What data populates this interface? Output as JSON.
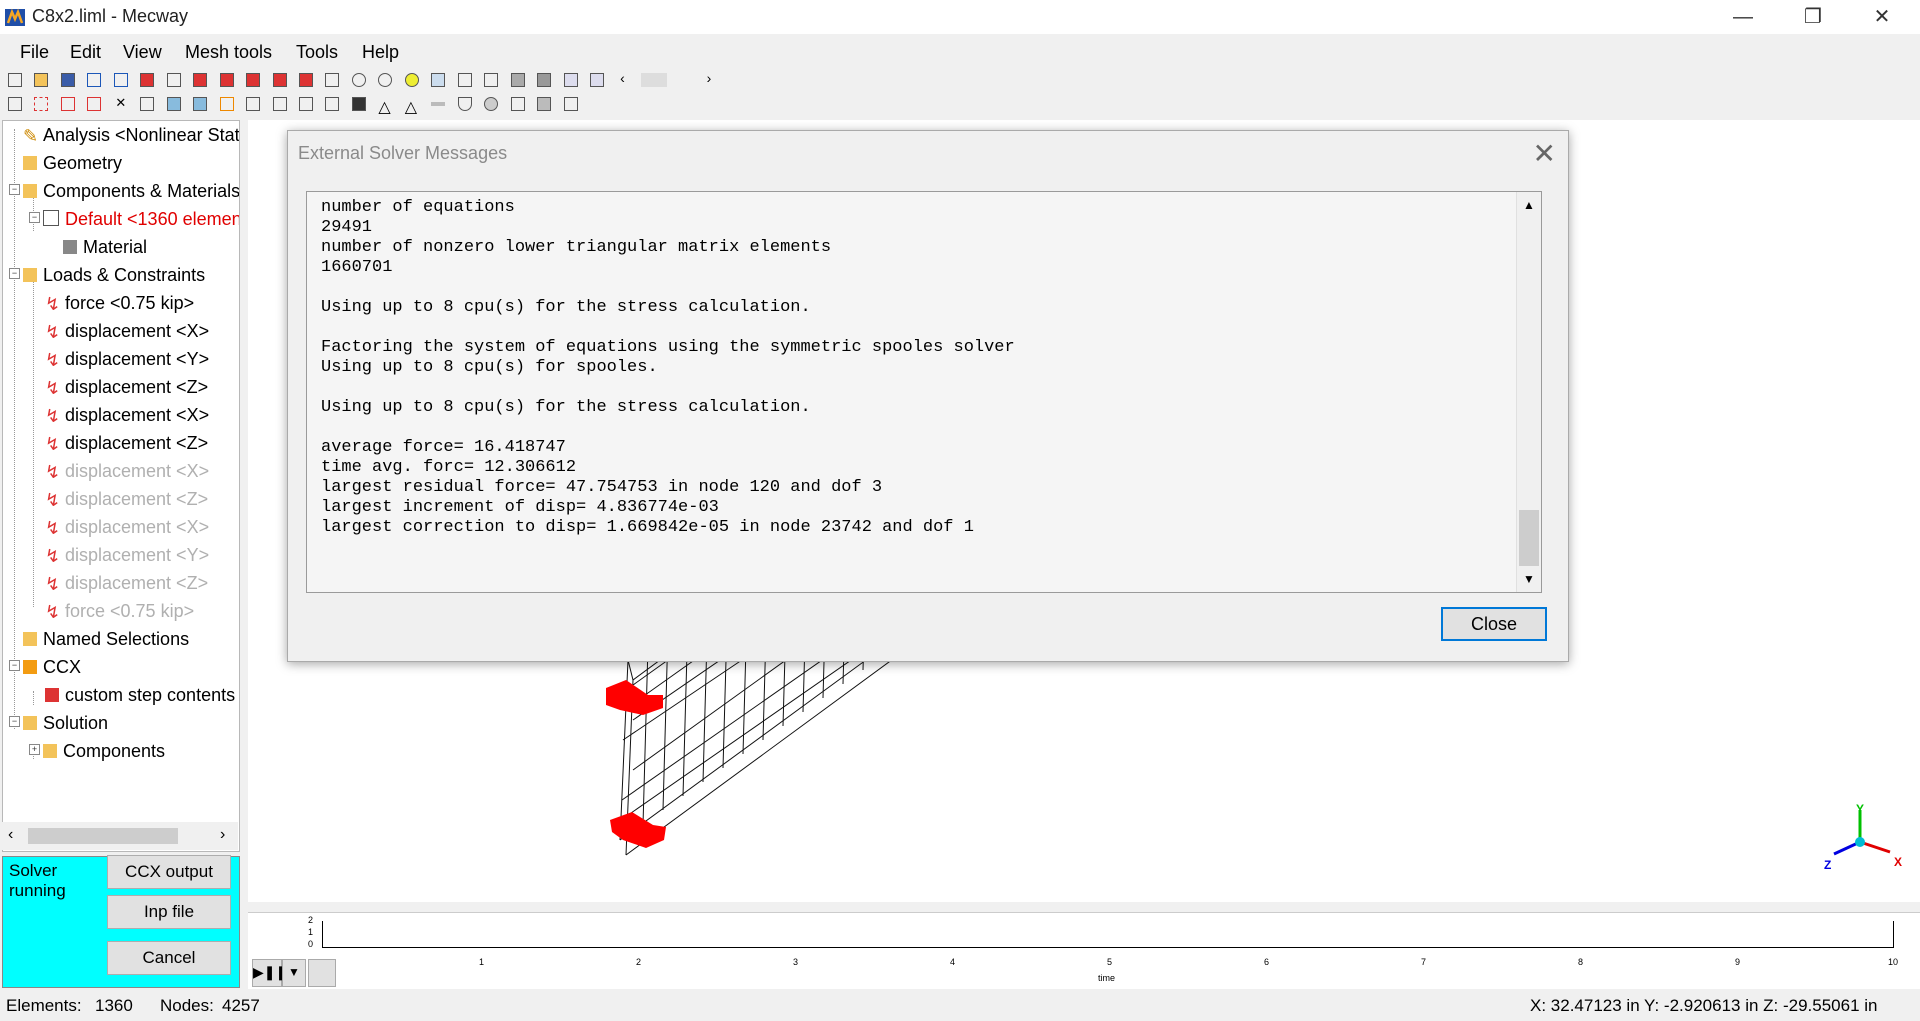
{
  "window": {
    "title": "C8x2.liml - Mecway",
    "minimize": "—",
    "restore": "❐",
    "close": "✕"
  },
  "menu": [
    "File",
    "Edit",
    "View",
    "Mesh tools",
    "Tools",
    "Help"
  ],
  "tree": [
    {
      "label": "Analysis <Nonlinear Stat",
      "state": "normal"
    },
    {
      "label": "Geometry",
      "state": "normal"
    },
    {
      "label": "Components & Materials",
      "state": "normal"
    },
    {
      "label": "Default <1360 elemen",
      "state": "red"
    },
    {
      "label": "Material",
      "state": "normal"
    },
    {
      "label": "Loads & Constraints",
      "state": "normal"
    },
    {
      "label": "force <0.75 kip>",
      "state": "normal"
    },
    {
      "label": "displacement <X>",
      "state": "normal"
    },
    {
      "label": "displacement <Y>",
      "state": "normal"
    },
    {
      "label": "displacement <Z>",
      "state": "normal"
    },
    {
      "label": "displacement <X>",
      "state": "normal"
    },
    {
      "label": "displacement <Z>",
      "state": "normal"
    },
    {
      "label": "displacement <X>",
      "state": "disabled"
    },
    {
      "label": "displacement <Z>",
      "state": "disabled"
    },
    {
      "label": "displacement <X>",
      "state": "disabled"
    },
    {
      "label": "displacement <Y>",
      "state": "disabled"
    },
    {
      "label": "displacement <Z>",
      "state": "disabled"
    },
    {
      "label": "force <0.75 kip>",
      "state": "disabled"
    },
    {
      "label": "Named Selections",
      "state": "normal"
    },
    {
      "label": "CCX",
      "state": "normal"
    },
    {
      "label": "custom step contents",
      "state": "normal"
    },
    {
      "label": "Solution",
      "state": "normal"
    },
    {
      "label": "Components",
      "state": "normal"
    }
  ],
  "solver": {
    "status": "Solver running",
    "ccx_output": "CCX output",
    "inp_file": "Inp file",
    "cancel": "Cancel"
  },
  "dialog": {
    "title": "External Solver Messages",
    "close_x": "✕",
    "messages": [
      "number of equations",
      "29491",
      "number of nonzero lower triangular matrix elements",
      "1660701",
      "",
      "Using up to 8 cpu(s) for the stress calculation.",
      "",
      "Factoring the system of equations using the symmetric spooles solver",
      "Using up to 8 cpu(s) for spooles.",
      "",
      "Using up to 8 cpu(s) for the stress calculation.",
      "",
      "average force= 16.418747",
      "time avg. forc= 12.306612",
      "largest residual force= 47.754753 in node 120 and dof 3",
      "largest increment of disp= 4.836774e-03",
      "largest correction to disp= 1.669842e-05 in node 23742 and dof 1"
    ],
    "close_button": "Close"
  },
  "axes_triad": {
    "x": "X",
    "y": "Y",
    "z": "Z"
  },
  "timeline": {
    "y_ticks": [
      "2",
      "1",
      "0"
    ],
    "x_ticks": [
      "1",
      "2",
      "3",
      "4",
      "5",
      "6",
      "7",
      "8",
      "9",
      "10"
    ],
    "xlabel": "time"
  },
  "status": {
    "elements_label": "Elements:",
    "elements": "1360",
    "nodes_label": "Nodes:",
    "nodes": "4257",
    "coords": "X: 32.47123 in Y: -2.920613 in Z: -29.55061 in"
  },
  "colors": {
    "accent": "#0078d7",
    "solver_bg": "#00ffff",
    "constraint": "#ff0000",
    "load": "#33cc33"
  }
}
